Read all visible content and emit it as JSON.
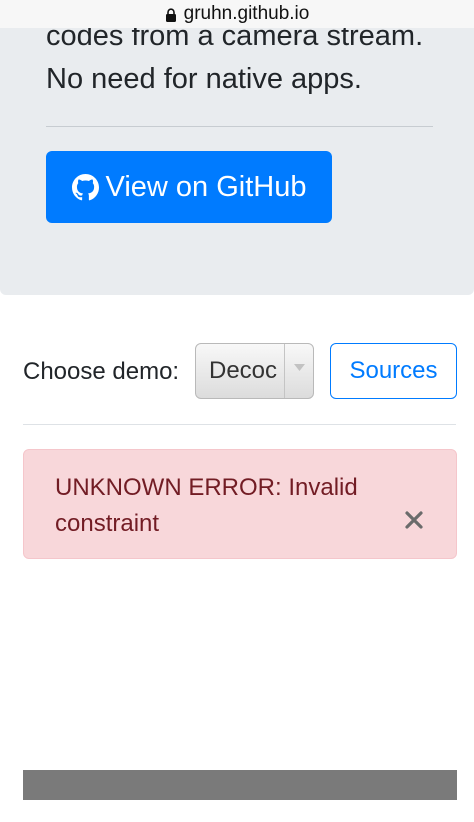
{
  "browser": {
    "url": "gruhn.github.io",
    "lock_icon": "lock-icon"
  },
  "hero": {
    "lead_line_1": "codes from a camera stream.",
    "lead_line_2": "No need for native apps.",
    "github_button_label": "View on GitHub",
    "github_icon": "github-icon",
    "button_color": "#007bff",
    "background_color": "#e9ecef"
  },
  "controls": {
    "choose_label": "Choose demo:",
    "demo_select_value": "Decoc",
    "sources_label": "Sources"
  },
  "alert": {
    "message": "UNKNOWN ERROR: Invalid constraint",
    "close_icon": "close-icon",
    "background_color": "#f8d7da",
    "text_color": "#721c24"
  }
}
